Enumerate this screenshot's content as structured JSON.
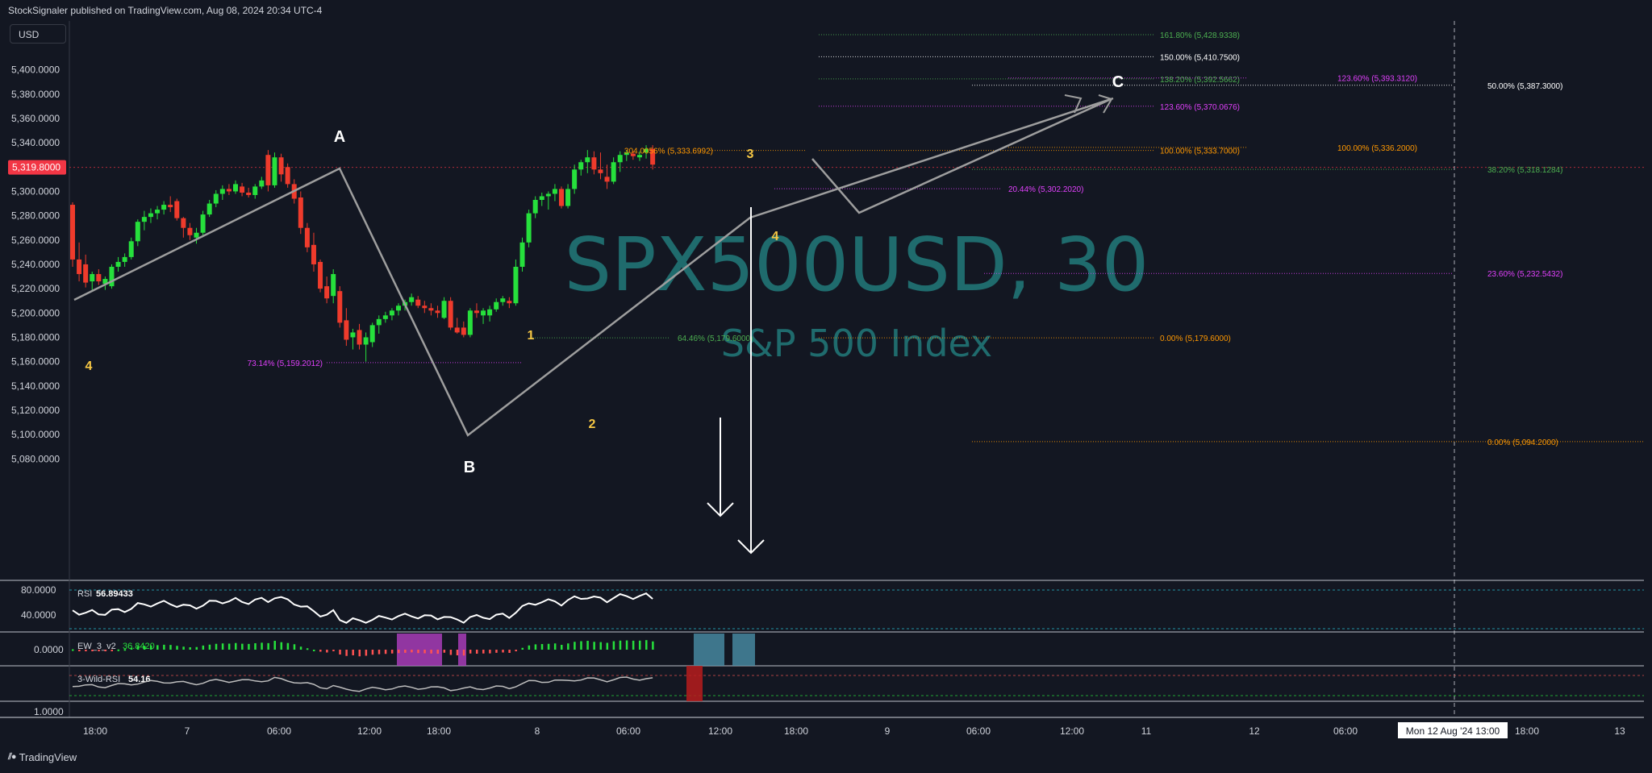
{
  "header": {
    "published": "StockSignaler published on TradingView.com, Aug 08, 2024 20:34 UTC-4"
  },
  "currency": "USD",
  "brand": "TradingView",
  "brand_icon": "tradingview-logo-icon",
  "watermark": {
    "symbol": "SPX500USD, 30",
    "name": "S&P 500 Index"
  },
  "chart_data": {
    "type": "candlestick",
    "symbol": "SPX500USD",
    "interval": "30",
    "description": "S&P 500 Index",
    "price_axis": {
      "ticks": [
        "5,400.0000",
        "5,380.0000",
        "5,360.0000",
        "5,340.0000",
        "5,320.0000",
        "5,300.0000",
        "5,280.0000",
        "5,260.0000",
        "5,240.0000",
        "5,220.0000",
        "5,200.0000",
        "5,180.0000",
        "5,160.0000",
        "5,140.0000",
        "5,120.0000",
        "5,100.0000",
        "5,080.0000"
      ],
      "range": [
        5069,
        5432
      ],
      "last_price": "5,319.8000"
    },
    "time_axis": {
      "labels": [
        "18:00",
        "7",
        "06:00",
        "12:00",
        "18:00",
        "8",
        "06:00",
        "12:00",
        "18:00",
        "9",
        "06:00",
        "12:00",
        "11",
        "12",
        "06:00",
        "18:00",
        "13"
      ],
      "crosshair_label": "Mon 12 Aug '24   13:00"
    },
    "candles": [
      [
        5289,
        5291,
        5238,
        5244
      ],
      [
        5244,
        5258,
        5226,
        5232
      ],
      [
        5240,
        5248,
        5221,
        5225
      ],
      [
        5226,
        5234,
        5219,
        5232
      ],
      [
        5232,
        5236,
        5223,
        5226
      ],
      [
        5224,
        5230,
        5219,
        5228
      ],
      [
        5222,
        5240,
        5220,
        5238
      ],
      [
        5238,
        5246,
        5234,
        5242
      ],
      [
        5242,
        5249,
        5238,
        5246
      ],
      [
        5246,
        5262,
        5244,
        5259
      ],
      [
        5259,
        5277,
        5255,
        5275
      ],
      [
        5275,
        5284,
        5268,
        5279
      ],
      [
        5279,
        5286,
        5274,
        5282
      ],
      [
        5282,
        5288,
        5277,
        5285
      ],
      [
        5285,
        5292,
        5281,
        5289
      ],
      [
        5289,
        5296,
        5283,
        5287
      ],
      [
        5292,
        5294,
        5276,
        5278
      ],
      [
        5278,
        5279,
        5262,
        5270
      ],
      [
        5270,
        5274,
        5260,
        5264
      ],
      [
        5262,
        5270,
        5257,
        5266
      ],
      [
        5266,
        5284,
        5264,
        5281
      ],
      [
        5281,
        5293,
        5279,
        5290
      ],
      [
        5290,
        5301,
        5287,
        5298
      ],
      [
        5298,
        5305,
        5293,
        5302
      ],
      [
        5302,
        5306,
        5297,
        5300
      ],
      [
        5300,
        5309,
        5298,
        5306
      ],
      [
        5304,
        5307,
        5296,
        5299
      ],
      [
        5299,
        5303,
        5295,
        5297
      ],
      [
        5297,
        5306,
        5294,
        5304
      ],
      [
        5304,
        5312,
        5302,
        5309
      ],
      [
        5330,
        5334,
        5300,
        5305
      ],
      [
        5305,
        5332,
        5303,
        5328
      ],
      [
        5328,
        5331,
        5308,
        5314
      ],
      [
        5320,
        5323,
        5303,
        5306
      ],
      [
        5306,
        5310,
        5290,
        5294
      ],
      [
        5295,
        5300,
        5265,
        5270
      ],
      [
        5270,
        5274,
        5250,
        5254
      ],
      [
        5256,
        5266,
        5234,
        5240
      ],
      [
        5242,
        5244,
        5217,
        5220
      ],
      [
        5222,
        5230,
        5208,
        5212
      ],
      [
        5214,
        5236,
        5208,
        5232
      ],
      [
        5218,
        5222,
        5188,
        5192
      ],
      [
        5194,
        5204,
        5173,
        5178
      ],
      [
        5180,
        5187,
        5170,
        5184
      ],
      [
        5186,
        5191,
        5170,
        5174
      ],
      [
        5174,
        5184,
        5160,
        5180
      ],
      [
        5176,
        5192,
        5172,
        5190
      ],
      [
        5190,
        5198,
        5183,
        5195
      ],
      [
        5195,
        5201,
        5192,
        5198
      ],
      [
        5198,
        5204,
        5194,
        5202
      ],
      [
        5202,
        5208,
        5198,
        5206
      ],
      [
        5206,
        5211,
        5202,
        5209
      ],
      [
        5209,
        5216,
        5206,
        5213
      ],
      [
        5211,
        5214,
        5204,
        5206
      ],
      [
        5206,
        5210,
        5200,
        5204
      ],
      [
        5204,
        5208,
        5198,
        5202
      ],
      [
        5202,
        5206,
        5196,
        5200
      ],
      [
        5196,
        5213,
        5195,
        5210
      ],
      [
        5210,
        5213,
        5186,
        5188
      ],
      [
        5188,
        5196,
        5183,
        5184
      ],
      [
        5188,
        5193,
        5180,
        5182
      ],
      [
        5182,
        5204,
        5180,
        5202
      ],
      [
        5202,
        5208,
        5196,
        5200
      ],
      [
        5198,
        5204,
        5191,
        5202
      ],
      [
        5198,
        5206,
        5193,
        5203
      ],
      [
        5203,
        5212,
        5201,
        5209
      ],
      [
        5209,
        5214,
        5206,
        5212
      ],
      [
        5210,
        5213,
        5204,
        5208
      ],
      [
        5208,
        5244,
        5206,
        5238
      ],
      [
        5238,
        5262,
        5234,
        5258
      ],
      [
        5258,
        5285,
        5254,
        5282
      ],
      [
        5282,
        5296,
        5278,
        5293
      ],
      [
        5293,
        5299,
        5288,
        5296
      ],
      [
        5296,
        5300,
        5285,
        5298
      ],
      [
        5298,
        5306,
        5292,
        5302
      ],
      [
        5302,
        5304,
        5286,
        5288
      ],
      [
        5288,
        5306,
        5286,
        5302
      ],
      [
        5302,
        5322,
        5298,
        5318
      ],
      [
        5318,
        5326,
        5313,
        5324
      ],
      [
        5324,
        5334,
        5315,
        5328
      ],
      [
        5328,
        5333,
        5314,
        5318
      ],
      [
        5318,
        5332,
        5310,
        5315
      ],
      [
        5312,
        5322,
        5302,
        5308
      ],
      [
        5308,
        5328,
        5306,
        5324
      ],
      [
        5324,
        5333,
        5316,
        5330
      ],
      [
        5330,
        5334,
        5325,
        5332
      ],
      [
        5331,
        5333,
        5326,
        5329
      ],
      [
        5328,
        5333,
        5325,
        5330
      ],
      [
        5332,
        5338,
        5327,
        5335
      ],
      [
        5335,
        5338,
        5318,
        5322
      ]
    ],
    "wave_labels": [
      {
        "text": "4",
        "color": "#f6c744"
      },
      {
        "text": "A",
        "color": "#ffffff"
      },
      {
        "text": "B",
        "color": "#ffffff"
      },
      {
        "text": "1",
        "color": "#f6c744"
      },
      {
        "text": "2",
        "color": "#f6c744"
      },
      {
        "text": "3",
        "color": "#f6c744"
      },
      {
        "text": "4",
        "color": "#f6c744"
      },
      {
        "text": "C",
        "color": "#ffffff"
      }
    ],
    "fib_levels": [
      {
        "label": "161.80% (5,428.9338)",
        "price": 5428.9338,
        "color": "#4caf50"
      },
      {
        "label": "150.00% (5,410.7500)",
        "price": 5410.75,
        "color": "#ffffff"
      },
      {
        "label": "138.20% (5,392.5662)",
        "price": 5392.5662,
        "color": "#4caf50"
      },
      {
        "label": "123.60% (5,393.3120)",
        "price": 5393.312,
        "color": "#e040fb"
      },
      {
        "label": "50.00% (5,387.3000)",
        "price": 5387.3,
        "color": "#ffffff"
      },
      {
        "label": "123.60% (5,370.0676)",
        "price": 5370.0676,
        "color": "#e040fb"
      },
      {
        "label": "304.0056% (5,333.6992)",
        "price": 5333.6992,
        "color": "#ff9800"
      },
      {
        "label": "100.00% (5,333.7000)",
        "price": 5333.7,
        "color": "#ff9800"
      },
      {
        "label": "100.00% (5,336.2000)",
        "price": 5336.2,
        "color": "#ff9800"
      },
      {
        "label": "38.20% (5,318.1284)",
        "price": 5318.1284,
        "color": "#4caf50"
      },
      {
        "label": "20.44% (5,302.2020)",
        "price": 5302.202,
        "color": "#e040fb"
      },
      {
        "label": "23.60% (5,232.5432)",
        "price": 5232.5432,
        "color": "#e040fb"
      },
      {
        "label": "64.46% (5,179.6000)",
        "price": 5179.6,
        "color": "#4caf50"
      },
      {
        "label": "0.00% (5,179.6000)",
        "price": 5179.6,
        "color": "#ff9800"
      },
      {
        "label": "73.14% (5,159.2012)",
        "price": 5159.2012,
        "color": "#e040fb"
      },
      {
        "label": "0.00% (5,094.2000)",
        "price": 5094.2,
        "color": "#ff9800"
      }
    ],
    "indicators": [
      {
        "name": "RSI",
        "value": "56.89433",
        "axis": [
          "80.0000",
          "40.0000"
        ]
      },
      {
        "name": "EW_3_v2",
        "value": "36.8420",
        "axis": [
          "0.0000"
        ]
      },
      {
        "name": "3-Wild-RSI",
        "value": "54.16",
        "axis": [
          "1.0000"
        ]
      }
    ],
    "colors": {
      "up": "#26e03c",
      "down": "#ef3b2c",
      "background": "#131722",
      "watermark": "#1f6b6d",
      "grid": "#363a45"
    }
  }
}
